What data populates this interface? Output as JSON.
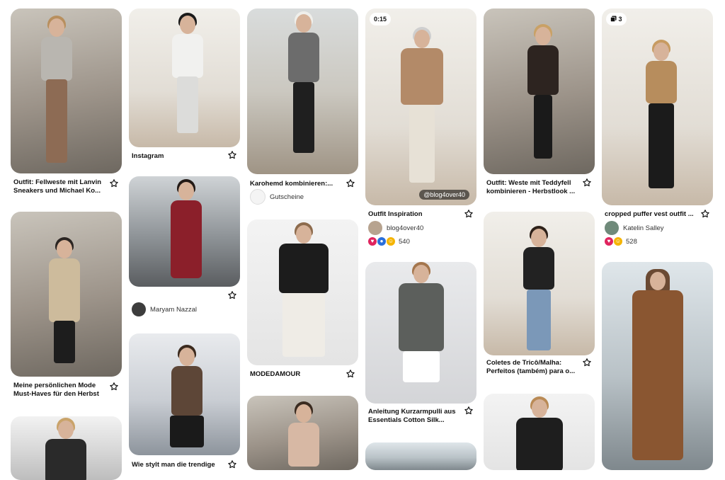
{
  "pins": [
    {
      "id": "c1-1",
      "title": "Outfit: Fellweste mit Lanvin Sneakers und Michael Ko..."
    },
    {
      "id": "c1-2",
      "title": "Meine persönlichen Mode Must-Haves für den Herbst"
    },
    {
      "id": "c1-3"
    },
    {
      "id": "c2-1",
      "title": "Instagram"
    },
    {
      "id": "c2-2",
      "creator": "Maryam Nazzal"
    },
    {
      "id": "c2-3",
      "title": "Wie stylt man die trendige"
    },
    {
      "id": "c3-1",
      "title": "Karohemd kombinieren:...",
      "creator": "Gutscheine"
    },
    {
      "id": "c3-2",
      "title": "MODEDAMOUR"
    },
    {
      "id": "c3-3"
    },
    {
      "id": "c4-1",
      "badge": "0:15",
      "watermark": "@blog4over40",
      "title": "Outfit Inspiration",
      "creator": "blog4over40",
      "reactions_count": "540"
    },
    {
      "id": "c4-2",
      "title": "Anleitung Kurzarmpulli aus Essentials Cotton Silk..."
    },
    {
      "id": "c4-3"
    },
    {
      "id": "c5-1",
      "title": "Outfit: Weste mit Teddyfell kombinieren - Herbstlook ..."
    },
    {
      "id": "c5-2",
      "title": "Coletes de Tricô/Malha: Perfeitos (também) para o..."
    },
    {
      "id": "c5-3"
    },
    {
      "id": "c6-1",
      "badge": "3",
      "title": "cropped puffer vest outfit ...",
      "creator": "Katelin Salley",
      "reactions_count": "528"
    },
    {
      "id": "c6-2"
    }
  ],
  "icons": {
    "save": "star-outline-icon",
    "multi_image": "multi-image-icon",
    "reaction_heart": "heart-reaction-icon",
    "reaction_wow": "wow-reaction-icon",
    "reaction_haha": "haha-reaction-icon"
  },
  "colors": {
    "background": "#ffffff",
    "title": "#111111",
    "meta": "#333333"
  }
}
